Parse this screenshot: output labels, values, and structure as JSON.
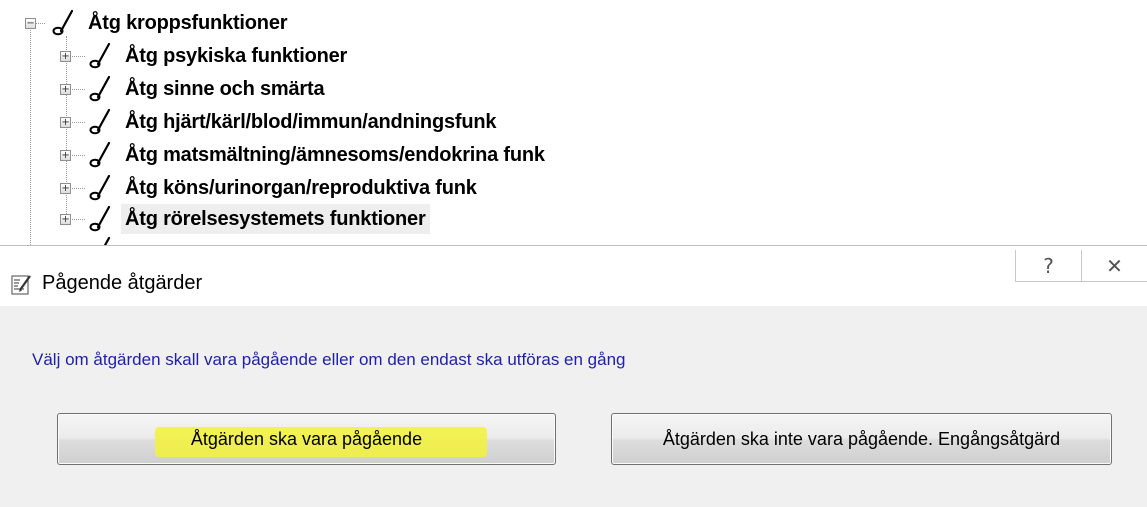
{
  "tree": {
    "root": {
      "label": "Åtg kroppsfunktioner",
      "expander": "−"
    },
    "children": [
      {
        "label": "Åtg psykiska funktioner",
        "expander": "+"
      },
      {
        "label": "Åtg sinne och smärta",
        "expander": "+"
      },
      {
        "label": "Åtg hjärt/kärl/blod/immun/andningsfunk",
        "expander": "+"
      },
      {
        "label": "Åtg matsmältning/ämnesoms/endokrina funk",
        "expander": "+"
      },
      {
        "label": "Åtg köns/urinorgan/reproduktiva funk",
        "expander": "+"
      },
      {
        "label": "Åtg rörelsesystemets funktioner",
        "expander": "+"
      }
    ]
  },
  "dialog": {
    "title": "Pågende åtgärder",
    "help_glyph": "?",
    "close_glyph": "✕",
    "instruction": "Välj om åtgärden skall vara pågående eller om den endast ska utföras en gång",
    "button_yes": "Åtgärden ska vara pågående",
    "button_no": "Åtgärden ska inte vara pågående. Engångsåtgärd",
    "highlight_color": "#f3f23a"
  }
}
